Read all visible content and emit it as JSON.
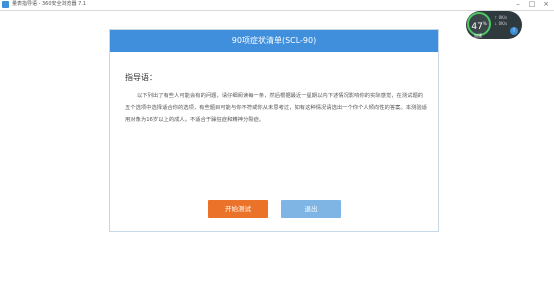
{
  "window": {
    "title": "量表指导语 - 360安全浏览器 7.1",
    "controls": [
      "–",
      "□",
      "×"
    ]
  },
  "monitor": {
    "percent": "47",
    "percent_unit": "%",
    "upload": "0K/s",
    "download": "0K/s",
    "label": "加速",
    "badge": "!"
  },
  "dialog": {
    "header": "90项症状清单(SCL-90)",
    "guide_title": "指导语：",
    "guide_text": "以下列出了有些人可能会有的问题，请仔细阅读每一条，然后根据最近一星期以内下述情况影响你的实际感觉，在测试题的五个选项中选择适合你的选项，有些题目可能与你不符或你从未思考过，如有这种情况请选出一个你个人倾向性的答案。本测验适用对象为16岁以上的成人。不适合于躁狂症和精神分裂症。",
    "start_button": "开始测试",
    "exit_button": "退出"
  },
  "colors": {
    "header_blue": "#3f8fdd",
    "start_orange": "#ea7229",
    "exit_blue": "#7fb5e4",
    "monitor_green": "#4bc865"
  }
}
